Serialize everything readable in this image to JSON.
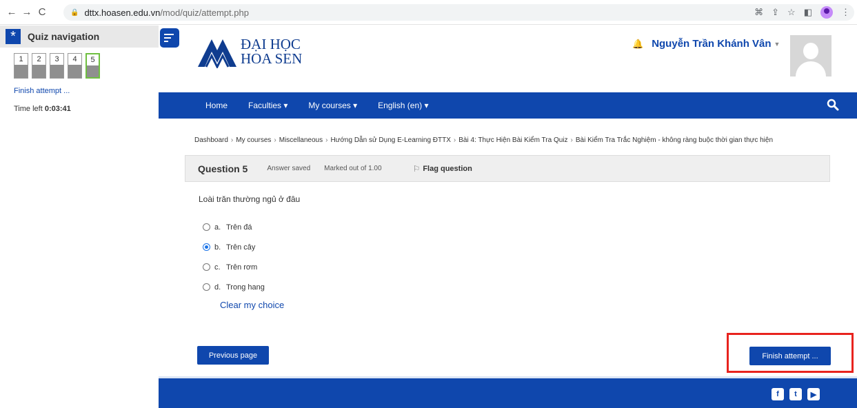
{
  "browser": {
    "url_host": "dttx.hoasen.edu.vn",
    "url_path": "/mod/quiz/attempt.php"
  },
  "drawer": {
    "title": "Quiz navigation",
    "questions": [
      "1",
      "2",
      "3",
      "4",
      "5"
    ],
    "current_question": "5",
    "finish_link": "Finish attempt ...",
    "time_left_label": "Time left",
    "time_left_value": "0:03:41"
  },
  "header": {
    "logo_line1": "ĐẠI HỌC",
    "logo_line2": "HOA SEN",
    "user_name": "Nguyễn Trần Khánh Vân"
  },
  "navbar": {
    "items": [
      "Home",
      "Faculties ▾",
      "My courses ▾",
      "English (en) ▾"
    ]
  },
  "breadcrumb": [
    "Dashboard",
    "My courses",
    "Miscellaneous",
    "Hướng Dẫn sử Dụng E-Learning ĐTTX",
    "Bài 4: Thực Hiện Bài Kiểm Tra Quiz",
    "Bài Kiểm Tra Trắc Nghiệm - không ràng buộc thời gian thực hiện"
  ],
  "question": {
    "number_label": "Question 5",
    "state": "Answer saved",
    "marks": "Marked out of 1.00",
    "flag_label": "Flag question",
    "text": "Loài trăn thường ngủ ở đâu",
    "answers": [
      {
        "letter": "a.",
        "text": "Trên đá",
        "checked": false
      },
      {
        "letter": "b.",
        "text": "Trên cây",
        "checked": true
      },
      {
        "letter": "c.",
        "text": "Trên rơm",
        "checked": false
      },
      {
        "letter": "d.",
        "text": "Trong hang",
        "checked": false
      }
    ],
    "clear_choice": "Clear my choice"
  },
  "buttons": {
    "previous": "Previous page",
    "finish": "Finish attempt ..."
  },
  "colors": {
    "brand": "#0f47ad",
    "highlight": "#e8231e",
    "current_question_border": "#6fbf40"
  }
}
